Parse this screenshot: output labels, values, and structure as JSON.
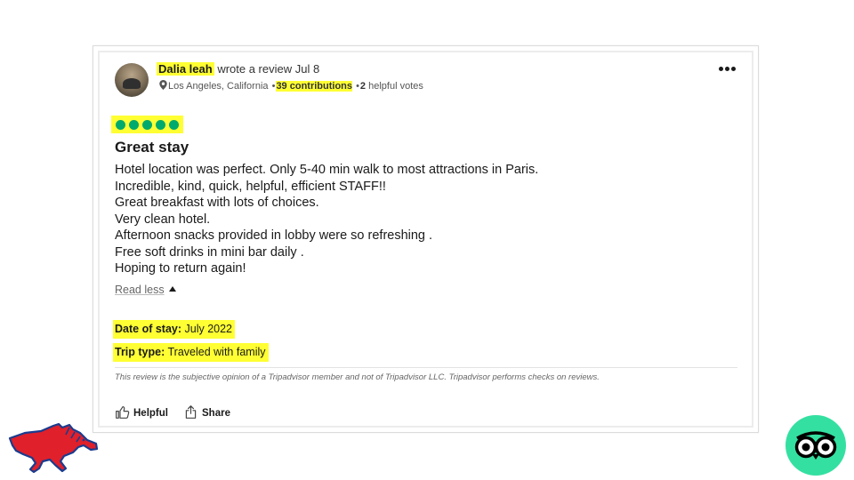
{
  "review": {
    "reviewer_name": "Dalia leah",
    "action_text": " wrote a review Jul 8",
    "location": "Los Angeles, California",
    "separator": "•",
    "contributions": "39 contributions",
    "helpful_votes_count": "2",
    "helpful_votes_label": " helpful votes",
    "rating": 5,
    "title": "Great stay",
    "body_lines": [
      "Hotel location was perfect. Only 5-40 min walk to most attractions in Paris.",
      "Incredible, kind, quick, helpful, efficient STAFF!!",
      "Great breakfast with lots of choices.",
      "Very clean hotel.",
      "Afternoon snacks provided in lobby were so refreshing .",
      "Free soft drinks in mini bar daily .",
      "Hoping to return again!"
    ],
    "read_less": "Read less",
    "date_of_stay_label": "Date of stay:",
    "date_of_stay_value": " July 2022",
    "trip_type_label": "Trip type:",
    "trip_type_value": " Traveled with family",
    "disclaimer": "This review is the subjective opinion of a Tripadvisor member and not of Tripadvisor LLC. Tripadvisor performs checks on reviews.",
    "helpful_button": "Helpful",
    "share_button": "Share"
  },
  "colors": {
    "highlight": "#ffff33",
    "bubble_green": "#00aa6c",
    "tripadvisor_green": "#34e0a1",
    "mustang_red": "#e0202a",
    "mustang_blue": "#1a3c8f"
  },
  "icons": {
    "location": "map-pin-icon",
    "menu": "more-dots-icon",
    "helpful": "thumbs-up-icon",
    "share": "share-icon",
    "left_logo": "mustang-logo",
    "right_logo": "tripadvisor-owl-logo"
  }
}
